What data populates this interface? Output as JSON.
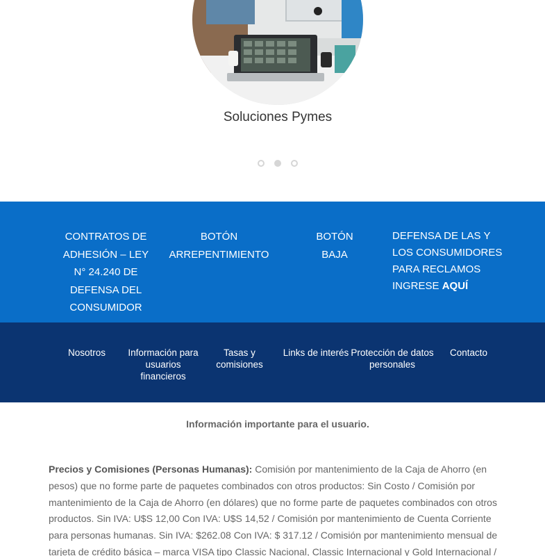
{
  "carousel": {
    "slide_title": "Soluciones Pymes",
    "dots": [
      "slide-1",
      "slide-2",
      "slide-3"
    ],
    "active_dot": 2
  },
  "blue_links": {
    "contratos": "CONTRATOS DE ADHESIÓN – LEY N° 24.240 DE DEFENSA DEL CONSUMIDOR",
    "arrepentimiento": "BOTÓN ARREPENTIMIENTO",
    "baja": "BOTÓN BAJA",
    "defensa_line1": "DEFENSA DE LAS Y LOS CONSUMIDORES PARA RECLAMOS INGRESE",
    "defensa_link": "AQUÍ"
  },
  "footer_nav": [
    "Nosotros",
    "Información para usuarios financieros",
    "Tasas y comisiones",
    "Links de interés",
    "Protección de datos personales",
    "Contacto"
  ],
  "info": {
    "title": "Información importante para el usuario.",
    "lead": "Precios y Comisiones (Personas Humanas):",
    "body": " Comisión por mantenimiento de la Caja de Ahorro (en pesos) que no forme parte de paquetes combinados con otros productos: Sin Costo / Comisión por mantenimiento de la Caja de Ahorro (en dólares) que no forme parte de paquetes combinados con otros productos. Sin IVA: U$S 12,00 Con IVA: U$S 14,52 / Comisión por mantenimiento de Cuenta Corriente para personas humanas. Sin IVA: $262.08 Con IVA: $ 317.12 / Comisión por mantenimiento mensual de tarjeta de crédito básica – marca VISA tipo Classic Nacional, Classic Internacional y Gold Internacional /"
  },
  "colors": {
    "blue_band": "#0a6ec8",
    "navy_band": "#0b3471",
    "dot": "#d6d6d6"
  }
}
